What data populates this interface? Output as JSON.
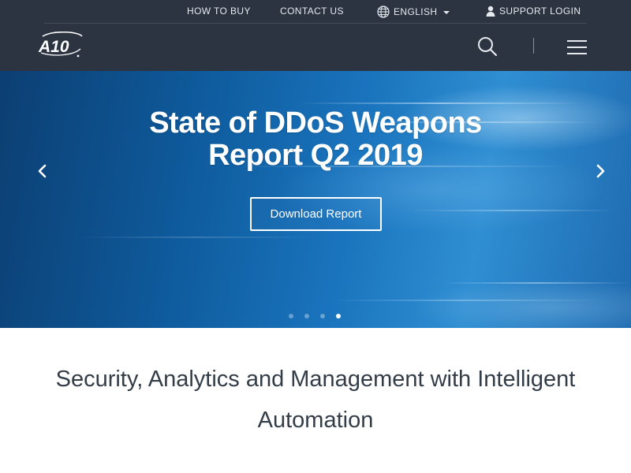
{
  "header": {
    "top_links": {
      "how_to_buy": "HOW TO BUY",
      "contact_us": "CONTACT US",
      "language": "ENGLISH",
      "support_login": "SUPPORT LOGIN"
    },
    "logo": "A10",
    "icons": {
      "globe": "globe-icon",
      "user": "user-icon",
      "search": "search-icon",
      "menu": "hamburger-menu-icon"
    }
  },
  "hero": {
    "title_line1": "State of DDoS Weapons",
    "title_line2": "Report Q2 2019",
    "cta_label": "Download Report",
    "slide_count": 4,
    "active_slide": 4
  },
  "intro": {
    "heading": "Security, Analytics and Management with Intelligent Automation"
  },
  "colors": {
    "header_bg": "#2b3440",
    "hero_blue": "#1a74bd",
    "text_white": "#ffffff",
    "heading_text": "#333d48"
  }
}
